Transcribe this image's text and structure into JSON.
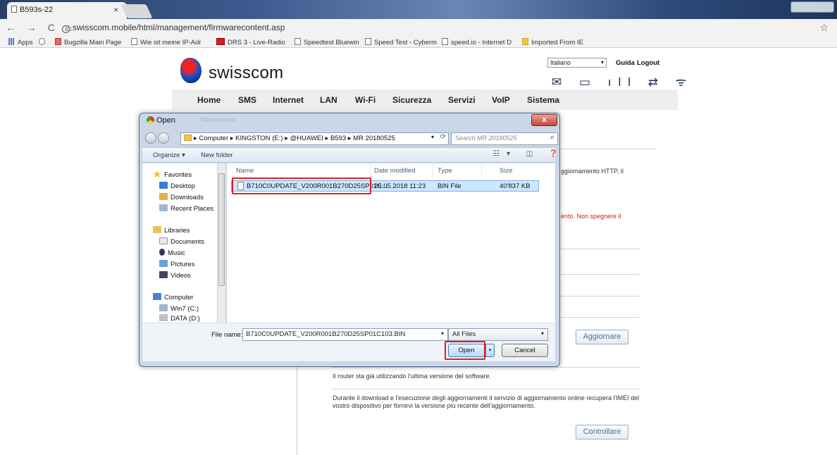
{
  "browser": {
    "tab_title": "B593s-22",
    "tab_close": "×",
    "url": "swisscom.mobile/html/management/firmwarecontent.asp",
    "nav_glyphs": "← → C ⌂",
    "info_glyph": "i",
    "star_glyph": "☆",
    "bookmarks": [
      {
        "label": "Apps",
        "icon": "apps-icon"
      },
      {
        "label": "",
        "icon": "history-icon"
      },
      {
        "label": "Bugzilla Main Page",
        "icon": "bugzilla-icon"
      },
      {
        "label": "Wie ist meine IP-Adr",
        "icon": "page-icon"
      },
      {
        "label": "DRS 3 - Live-Radio",
        "icon": "srf-icon"
      },
      {
        "label": "Speedtest Bluewin",
        "icon": "page-icon"
      },
      {
        "label": "Speed Test - Cyberm",
        "icon": "page-icon"
      },
      {
        "label": "speed.io - Internet D",
        "icon": "page-icon"
      },
      {
        "label": "Imported From IE",
        "icon": "folder-icon"
      }
    ]
  },
  "site": {
    "logo_text": "swisscom",
    "language": "Italiano",
    "guida": "Guida",
    "logout": "Logout",
    "status_glyphs": "✉ ▭ ıll ⇄ ᯤ",
    "menu": [
      "Home",
      "SMS",
      "Internet",
      "LAN",
      "Wi-Fi",
      "Sicurezza",
      "Servizi",
      "VoIP",
      "Sistema"
    ],
    "partial_text_1": "ggiornamento HTTP, il",
    "partial_text_2": "ento. Non spegnere il",
    "update_button": "Aggiornare",
    "latest_text": "Il router sta già utilizzando l'ultima versione del software.",
    "imei_text_1": "Durante il download e l'esecuzione degli aggiornamenti il servizio di aggiornamento online recupera l'IMEI del",
    "imei_text_2": "vostro dispositivo per fornirvi la versione più recente dell'aggiornamento.",
    "check_button": "Controllare"
  },
  "dialog": {
    "title": "Open",
    "faded_title": "Panoramica",
    "close_glyph": "x",
    "path": [
      "Computer",
      "KINGSTON (E:)",
      "@HUAWEI",
      "B593",
      "MR 20180525"
    ],
    "path_text": "▸ Computer ▸ KINGSTON (E:) ▸ @HUAWEI ▸ B593 ▸ MR 20180525",
    "search_placeholder": "Search MR 20180525",
    "organize": "Organize ▾",
    "new_folder": "New folder",
    "view_glyphs": "☷▾ ◫ ❓",
    "nav": {
      "favorites": "Favorites",
      "desktop": "Desktop",
      "downloads": "Downloads",
      "recent": "Recent Places",
      "libraries": "Libraries",
      "documents": "Documents",
      "music": "Music",
      "pictures": "Pictures",
      "videos": "Videos",
      "computer": "Computer",
      "win7": "Win7 (C:)",
      "data": "DATA (D:)"
    },
    "columns": [
      "Name",
      "Date modified",
      "Type",
      "Size"
    ],
    "file": {
      "name": "B710C0UPDATE_V200R001B270D25SP01C...",
      "date": "25.05.2018 11:23",
      "type": "BIN File",
      "size": "40'837 KB"
    },
    "file_name_label": "File name:",
    "file_name_value": "B710C0UPDATE_V200R001B270D25SP01C103.BIN",
    "filter": "All Files",
    "open": "Open",
    "cancel": "Cancel",
    "dropdown_glyph": "▾"
  },
  "colors": {
    "highlight": "#e02020",
    "selected_row": "#cce8ff",
    "dialog_frame": "#c9d7e9",
    "menu_bg": "#eeeeee",
    "red_text": "#d02020"
  }
}
